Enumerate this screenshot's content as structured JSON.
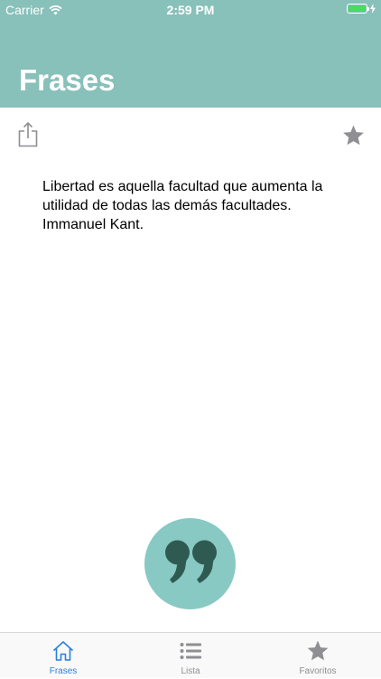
{
  "status_bar": {
    "carrier": "Carrier",
    "time": "2:59 PM"
  },
  "header": {
    "title": "Frases",
    "background_color": "#88c0ba"
  },
  "toolbar": {
    "share_icon": "share-icon",
    "favorite_icon": "star-icon"
  },
  "quote": {
    "text": "Libertad es aquella facultad que aumenta la utilidad de todas las demás facultades. Immanuel Kant."
  },
  "new_quote_button": {
    "icon": "quote-marks-icon",
    "color": "#88c9c4"
  },
  "tab_bar": {
    "tabs": [
      {
        "label": "Frases",
        "icon": "home-icon",
        "selected": true
      },
      {
        "label": "Lista",
        "icon": "list-icon",
        "selected": false
      },
      {
        "label": "Favoritos",
        "icon": "star-icon",
        "selected": false
      }
    ],
    "active_color": "#2b7fe0",
    "inactive_color": "#8e8e93"
  }
}
